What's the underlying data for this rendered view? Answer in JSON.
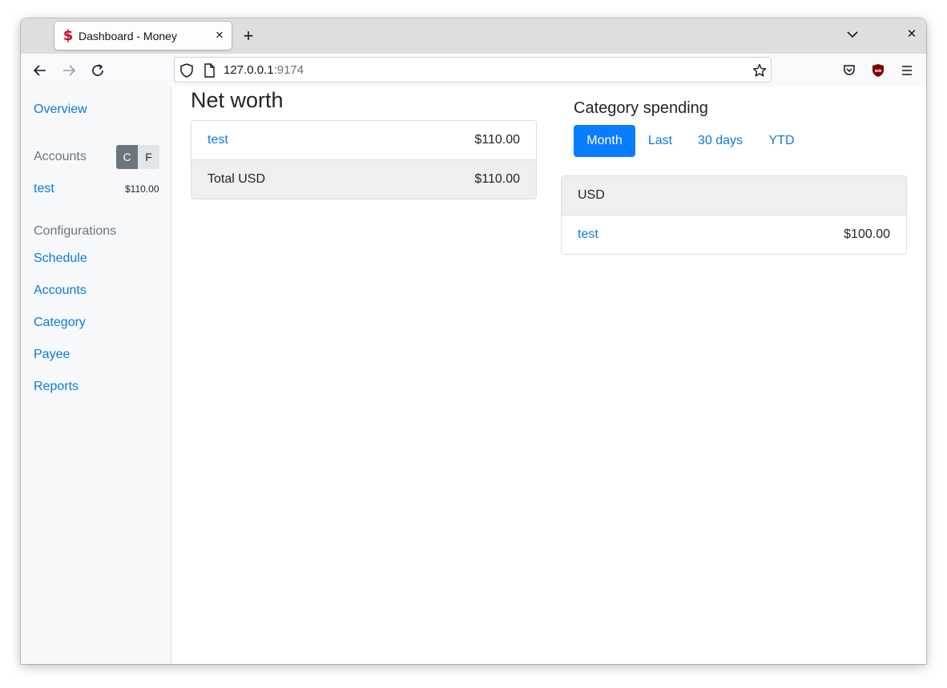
{
  "browser": {
    "tab_title": "Dashboard - Money",
    "favicon_glyph": "$",
    "new_tab_glyph": "+",
    "close_tab_glyph": "×",
    "window_close_glyph": "✕",
    "url_host": "127.0.0.1",
    "url_port": ":9174"
  },
  "sidebar": {
    "overview": "Overview",
    "accounts_heading": "Accounts",
    "toggle_c": "C",
    "toggle_f": "F",
    "account_name": "test",
    "account_amount": "$110.00",
    "config_heading": "Configurations",
    "config_items": [
      "Schedule",
      "Accounts",
      "Category",
      "Payee",
      "Reports"
    ]
  },
  "net_worth": {
    "title": "Net worth",
    "rows": [
      {
        "label": "test",
        "amount": "$110.00"
      }
    ],
    "total_label": "Total USD",
    "total_amount": "$110.00"
  },
  "category_spending": {
    "title": "Category spending",
    "periods": [
      "Month",
      "Last",
      "30 days",
      "YTD"
    ],
    "active_period": "Month",
    "currency_header": "USD",
    "rows": [
      {
        "label": "test",
        "amount": "$100.00"
      }
    ]
  },
  "colors": {
    "link": "#0d7ae2",
    "active_button": "#0a7cff",
    "toggle_active": "#6c757d",
    "favicon": "#d70022"
  }
}
